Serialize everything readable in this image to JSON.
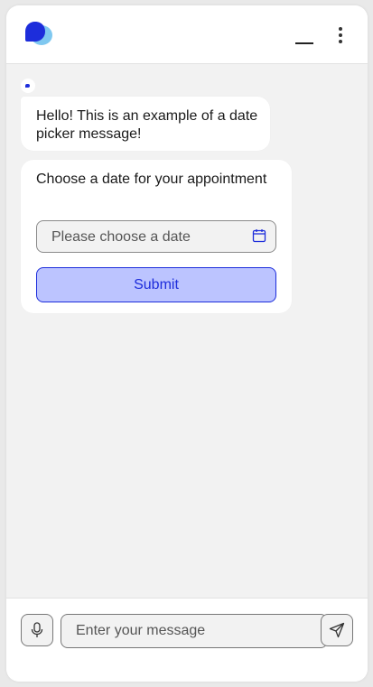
{
  "header": {
    "logo_icon": "chat-bubble-logo-icon",
    "minimize_icon": "minimize-icon",
    "menu_icon": "kebab-menu-icon"
  },
  "messages": [
    {
      "sender": "bot",
      "text": "Hello! This is an example of a date picker message!"
    },
    {
      "sender": "bot",
      "text": "Choose a date for your appointment",
      "date_picker": {
        "placeholder": "Please choose a date",
        "icon": "calendar-icon"
      },
      "submit_label": "Submit"
    }
  ],
  "composer": {
    "placeholder": "Enter your message",
    "value": "",
    "mic_icon": "microphone-icon",
    "send_icon": "send-icon"
  },
  "colors": {
    "accent": "#1d2ddb",
    "submit_bg": "#bcc4ff",
    "logo_light": "#7fc8f0",
    "background": "#f2f2f2"
  }
}
